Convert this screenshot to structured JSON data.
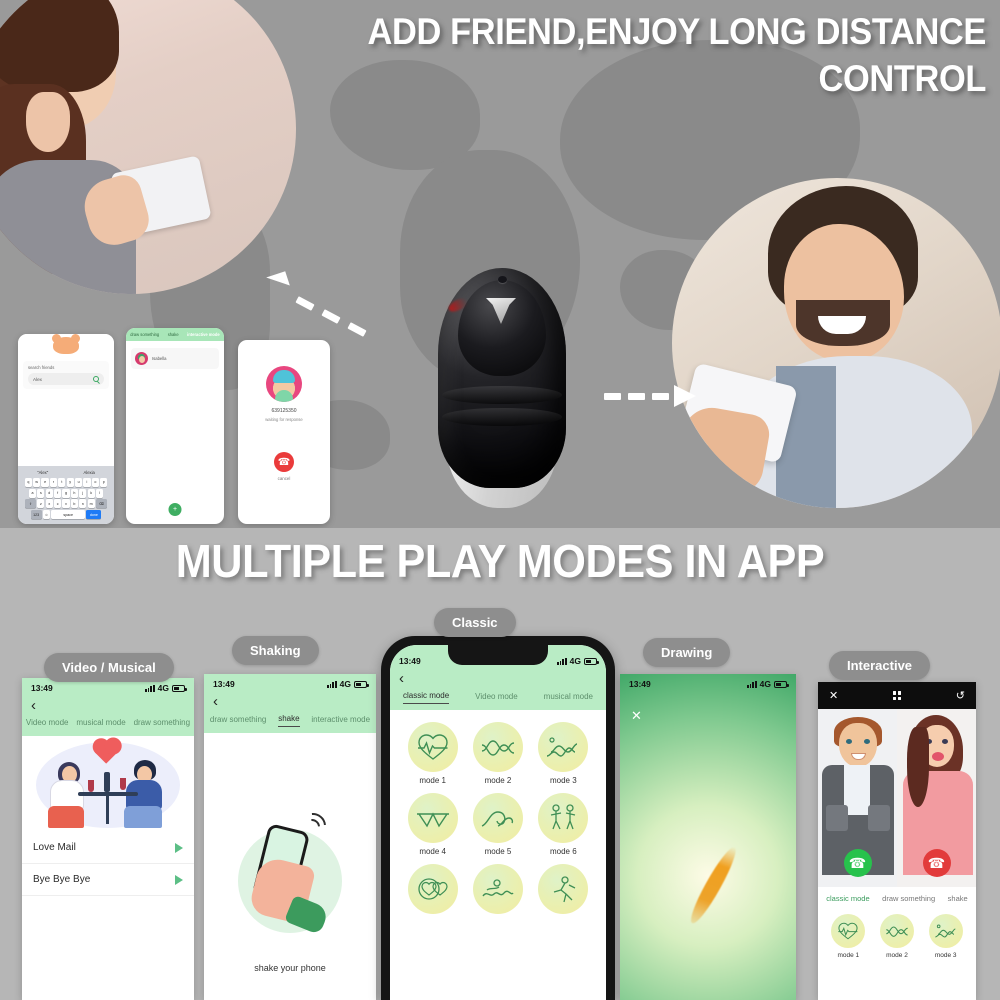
{
  "top_section": {
    "headline": "ADD FRIEND,ENJOY LONG DISTANCE CONTROL",
    "background": "world-map",
    "accent_gray": "#9a9a9a",
    "photo_left_alt": "woman lying down using smartphone",
    "photo_right_alt": "man smiling looking at smartphone",
    "product_alt": "black wearable massager device with silver chevron emblem",
    "arrow_left_label": "dashed-arrow-to-woman",
    "arrow_right_label": "dashed-arrow-to-man"
  },
  "mini_phones": {
    "search_screen": {
      "card_label": "search friends",
      "search_value": "Alex",
      "search_icon": "magnifier-icon",
      "mascot": "bear-icon",
      "suggestions": [
        "\"Alex\"",
        "Alexia"
      ],
      "keyboard_rows": [
        [
          "q",
          "w",
          "e",
          "r",
          "t",
          "y",
          "u",
          "i",
          "o",
          "p"
        ],
        [
          "a",
          "s",
          "d",
          "f",
          "g",
          "h",
          "j",
          "k",
          "l"
        ],
        [
          "⇧",
          "z",
          "x",
          "c",
          "v",
          "b",
          "n",
          "m",
          "⌫"
        ]
      ],
      "space_key": "space",
      "done_key": "done",
      "numeric_key": "123",
      "emoji_key": "☺"
    },
    "friends_screen": {
      "tabs": [
        "draw something",
        "shake",
        "interactive mode"
      ],
      "active_tab": "interactive mode",
      "contact_name": "Isabella",
      "fab_icon": "plus-icon"
    },
    "call_screen": {
      "number": "639125350",
      "status": "waiting for response",
      "hangup_icon": "phone-hangup-icon",
      "cancel_label": "cancel"
    }
  },
  "bottom_section": {
    "headline": "MULTIPLE PLAY MODES IN APP",
    "pills": [
      {
        "label": "Video / Musical"
      },
      {
        "label": "Shaking"
      },
      {
        "label": "Classic"
      },
      {
        "label": "Drawing"
      },
      {
        "label": "Interactive"
      }
    ]
  },
  "status_bar": {
    "time": "13:49",
    "network": "4G",
    "signal_icon": "signal-bars-icon",
    "battery_icon": "battery-icon"
  },
  "video_musical_screen": {
    "back_icon": "chevron-left-icon",
    "tabs": [
      "Video mode",
      "musical mode",
      "draw something"
    ],
    "active_tab": "musical mode",
    "illustration_alt": "couple at table with heart",
    "list": [
      {
        "title": "Love Mail",
        "play_icon": "play-icon"
      },
      {
        "title": "Bye Bye Bye",
        "play_icon": "play-icon"
      }
    ]
  },
  "shaking_screen": {
    "back_icon": "chevron-left-icon",
    "tabs": [
      "draw something",
      "shake",
      "interactive mode"
    ],
    "active_tab": "shake",
    "caption": "shake your phone",
    "illustration_alt": "hand holding phone with motion waves"
  },
  "classic_screen": {
    "back_icon": "chevron-left-icon",
    "tabs": [
      "classic mode",
      "Video mode",
      "musical mode"
    ],
    "active_tab": "classic mode",
    "modes": [
      {
        "label": "mode 1",
        "icon": "heartbeat-icon"
      },
      {
        "label": "mode 2",
        "icon": "double-wave-icon"
      },
      {
        "label": "mode 3",
        "icon": "rising-wave-icon"
      },
      {
        "label": "mode 4",
        "icon": "zigzag-peaks-icon"
      },
      {
        "label": "mode 5",
        "icon": "ocean-wave-icon"
      },
      {
        "label": "mode 6",
        "icon": "dancer-icon"
      },
      {
        "label": "",
        "icon": "hearts-circle-icon"
      },
      {
        "label": "",
        "icon": "swimmer-icon"
      },
      {
        "label": "",
        "icon": "runner-icon"
      }
    ]
  },
  "drawing_screen": {
    "close_icon": "close-icon",
    "canvas_alt": "green glowing canvas with orange brush stroke",
    "stroke_color": "#f0a020"
  },
  "interactive_screen": {
    "topbar_icons": [
      "close-icon",
      "grid-icon",
      "flip-camera-icon"
    ],
    "left_avatar_alt": "cartoon man in plaid shirt",
    "right_avatar_alt": "cartoon woman in pink top",
    "accept_icon": "phone-accept-icon",
    "decline_icon": "phone-decline-icon",
    "accept_color": "#27c24c",
    "decline_color": "#e23b3b",
    "tabs": [
      "classic mode",
      "draw something",
      "shake"
    ],
    "active_tab": "classic mode",
    "modes": [
      {
        "label": "mode 1",
        "icon": "heartbeat-icon"
      },
      {
        "label": "mode 2",
        "icon": "double-wave-icon"
      },
      {
        "label": "mode 3",
        "icon": "rising-wave-icon"
      }
    ]
  }
}
